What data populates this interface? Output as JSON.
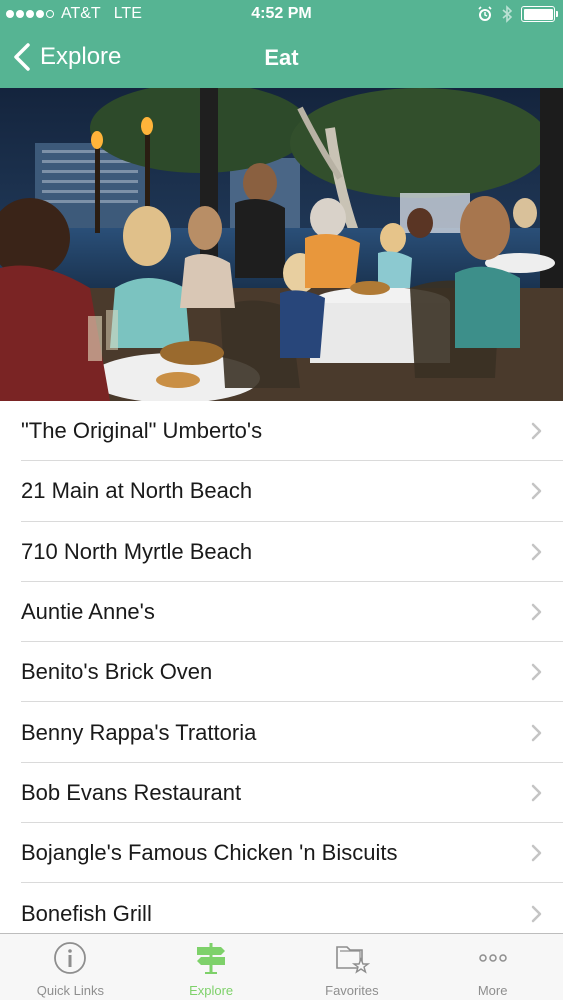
{
  "status_bar": {
    "carrier": "AT&T",
    "network": "LTE",
    "time": "4:52 PM"
  },
  "nav": {
    "back_label": "Explore",
    "title": "Eat"
  },
  "hero": {
    "icon": "restaurant-photo"
  },
  "list": {
    "items": [
      {
        "label": "\"The Original\" Umberto's"
      },
      {
        "label": "21 Main at North Beach"
      },
      {
        "label": "710 North Myrtle Beach"
      },
      {
        "label": "Auntie Anne's"
      },
      {
        "label": "Benito's Brick Oven"
      },
      {
        "label": "Benny Rappa's Trattoria"
      },
      {
        "label": "Bob Evans Restaurant"
      },
      {
        "label": "Bojangle's Famous Chicken 'n Biscuits"
      },
      {
        "label": "Bonefish Grill"
      }
    ]
  },
  "tab_bar": {
    "tabs": [
      {
        "label": "Quick Links",
        "icon": "info-icon",
        "active": false
      },
      {
        "label": "Explore",
        "icon": "signpost-icon",
        "active": true
      },
      {
        "label": "Favorites",
        "icon": "folder-star-icon",
        "active": false
      },
      {
        "label": "More",
        "icon": "more-dots-icon",
        "active": false
      }
    ]
  },
  "colors": {
    "header_green": "#56b493",
    "active_tab": "#7ed16a",
    "inactive_tab": "#8e8e8e"
  }
}
